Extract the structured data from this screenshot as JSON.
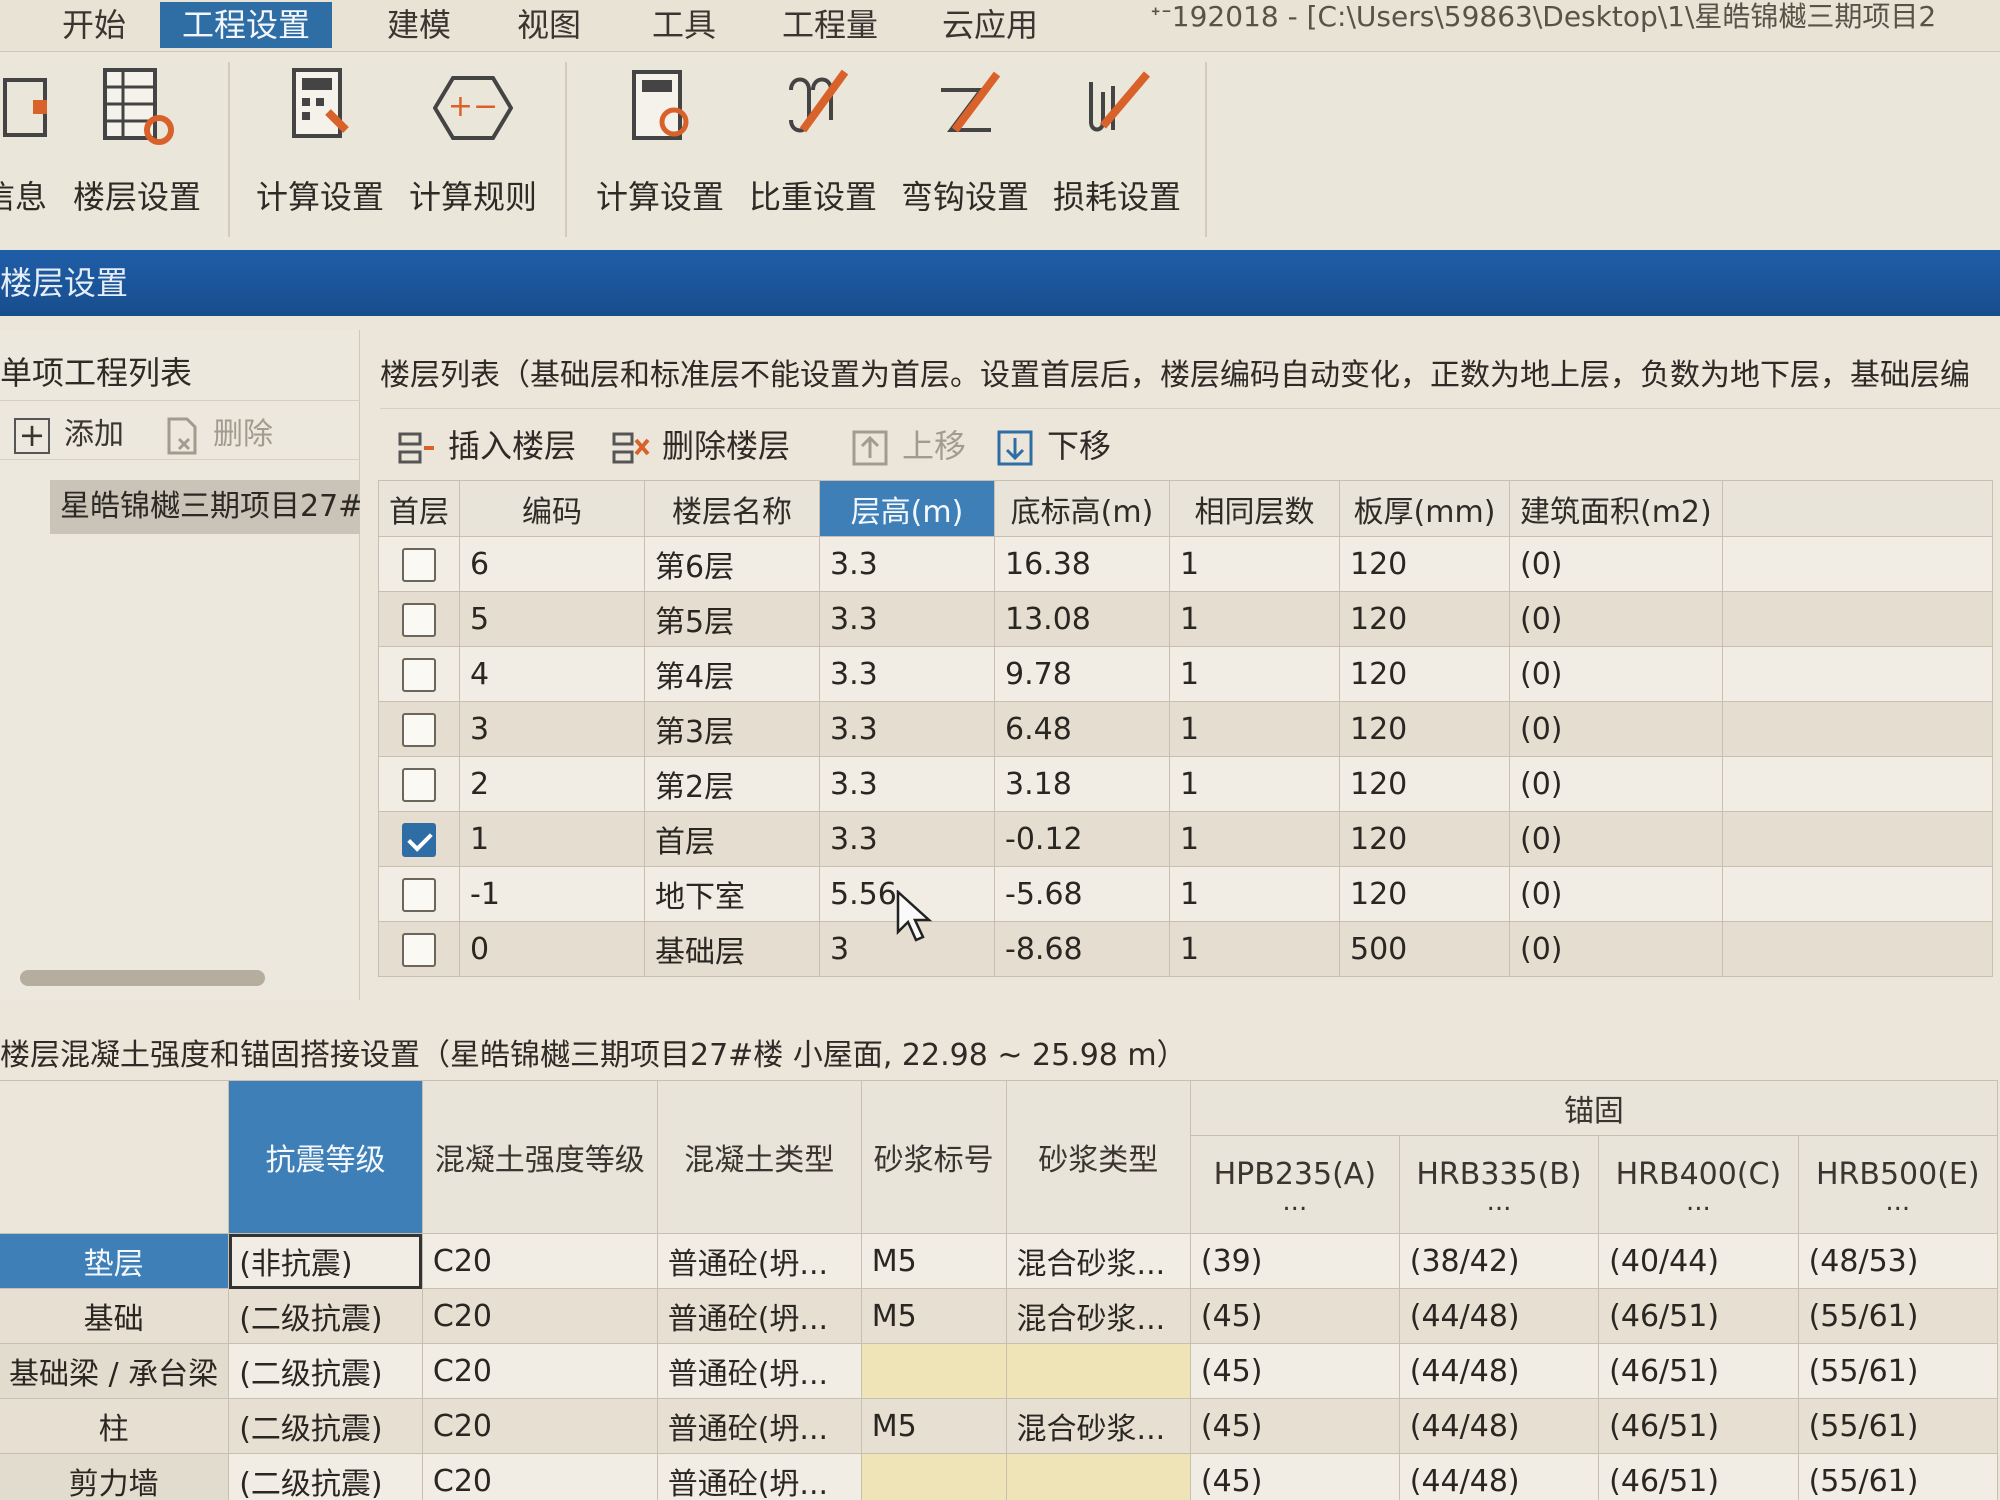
{
  "menu": {
    "items": [
      "开始",
      "工程设置",
      "建模",
      "视图",
      "工具",
      "工程量",
      "云应用"
    ],
    "active_index": 1,
    "title_path": "ᐩᐨ192018 - [C:\\Users\\59863\\Desktop\\1\\星皓锦樾三期项目2"
  },
  "ribbon": {
    "buttons": [
      {
        "label": "信息",
        "icon": "info-icon"
      },
      {
        "label": "楼层设置",
        "icon": "floor-settings-icon"
      },
      {
        "label": "计算设置",
        "icon": "calc-settings-icon"
      },
      {
        "label": "计算规则",
        "icon": "calc-rules-icon"
      },
      {
        "label": "计算设置",
        "icon": "rebar-calc-settings-icon"
      },
      {
        "label": "比重设置",
        "icon": "density-settings-icon"
      },
      {
        "label": "弯钩设置",
        "icon": "hook-settings-icon"
      },
      {
        "label": "损耗设置",
        "icon": "loss-settings-icon"
      }
    ]
  },
  "panel_title": "楼层设置",
  "left_panel": {
    "title": "单项工程列表",
    "add_label": "添加",
    "delete_label": "删除",
    "project_item": "星皓锦樾三期项目27#"
  },
  "floor_list": {
    "caption": "楼层列表（基础层和标准层不能设置为首层。设置首层后，楼层编码自动变化，正数为地上层，负数为地下层，基础层编",
    "toolbar": {
      "insert": "插入楼层",
      "delete": "删除楼层",
      "up": "上移",
      "down": "下移"
    },
    "columns": [
      "首层",
      "编码",
      "楼层名称",
      "层高(m)",
      "底标高(m)",
      "相同层数",
      "板厚(mm)",
      "建筑面积(m2)"
    ],
    "rows": [
      {
        "first": false,
        "code": "6",
        "name": "第6层",
        "height": "3.3",
        "bottom": "16.38",
        "same": "1",
        "slab": "120",
        "area": "(0)"
      },
      {
        "first": false,
        "code": "5",
        "name": "第5层",
        "height": "3.3",
        "bottom": "13.08",
        "same": "1",
        "slab": "120",
        "area": "(0)"
      },
      {
        "first": false,
        "code": "4",
        "name": "第4层",
        "height": "3.3",
        "bottom": "9.78",
        "same": "1",
        "slab": "120",
        "area": "(0)"
      },
      {
        "first": false,
        "code": "3",
        "name": "第3层",
        "height": "3.3",
        "bottom": "6.48",
        "same": "1",
        "slab": "120",
        "area": "(0)"
      },
      {
        "first": false,
        "code": "2",
        "name": "第2层",
        "height": "3.3",
        "bottom": "3.18",
        "same": "1",
        "slab": "120",
        "area": "(0)"
      },
      {
        "first": true,
        "code": "1",
        "name": "首层",
        "height": "3.3",
        "bottom": "-0.12",
        "same": "1",
        "slab": "120",
        "area": "(0)"
      },
      {
        "first": false,
        "code": "-1",
        "name": "地下室",
        "height": "5.56",
        "bottom": "-5.68",
        "same": "1",
        "slab": "120",
        "area": "(0)"
      },
      {
        "first": false,
        "code": "0",
        "name": "基础层",
        "height": "3",
        "bottom": "-8.68",
        "same": "1",
        "slab": "500",
        "area": "(0)"
      }
    ]
  },
  "concrete": {
    "caption": "楼层混凝土强度和锚固搭接设置（星皓锦樾三期项目27#楼  小屋面, 22.98 ~ 25.98 m）",
    "columns": [
      "抗震等级",
      "混凝土强度等级",
      "混凝土类型",
      "砂浆标号",
      "砂浆类型"
    ],
    "anchor_group": "锚固",
    "anchor_columns": [
      "HPB235(A)",
      "HRB335(B)",
      "HRB400(C)",
      "HRB500(E)"
    ],
    "anchor_sub": "...",
    "rows": [
      {
        "name": "垫层",
        "seismic": "(非抗震)",
        "strength": "C20",
        "type": "普通砼(坍...",
        "mortar_no": "M5",
        "mortar_type": "混合砂浆...",
        "a": "(39)",
        "b": "(38/42)",
        "c": "(40/44)",
        "e": "(48/53)"
      },
      {
        "name": "基础",
        "seismic": "(二级抗震)",
        "strength": "C20",
        "type": "普通砼(坍...",
        "mortar_no": "M5",
        "mortar_type": "混合砂浆...",
        "a": "(45)",
        "b": "(44/48)",
        "c": "(46/51)",
        "e": "(55/61)"
      },
      {
        "name": "基础梁 / 承台梁",
        "seismic": "(二级抗震)",
        "strength": "C20",
        "type": "普通砼(坍...",
        "mortar_no": "",
        "mortar_type": "",
        "a": "(45)",
        "b": "(44/48)",
        "c": "(46/51)",
        "e": "(55/61)"
      },
      {
        "name": "柱",
        "seismic": "(二级抗震)",
        "strength": "C20",
        "type": "普通砼(坍...",
        "mortar_no": "M5",
        "mortar_type": "混合砂浆...",
        "a": "(45)",
        "b": "(44/48)",
        "c": "(46/51)",
        "e": "(55/61)"
      },
      {
        "name": "剪力墙",
        "seismic": "(二级抗震)",
        "strength": "C20",
        "type": "普通砼(坍...",
        "mortar_no": "",
        "mortar_type": "",
        "a": "(45)",
        "b": "(44/48)",
        "c": "(46/51)",
        "e": "(55/61)"
      }
    ]
  },
  "colors": {
    "accent": "#2f6da5",
    "header_bar": "#1f5ea8",
    "selected_header": "#3f7fb8"
  }
}
